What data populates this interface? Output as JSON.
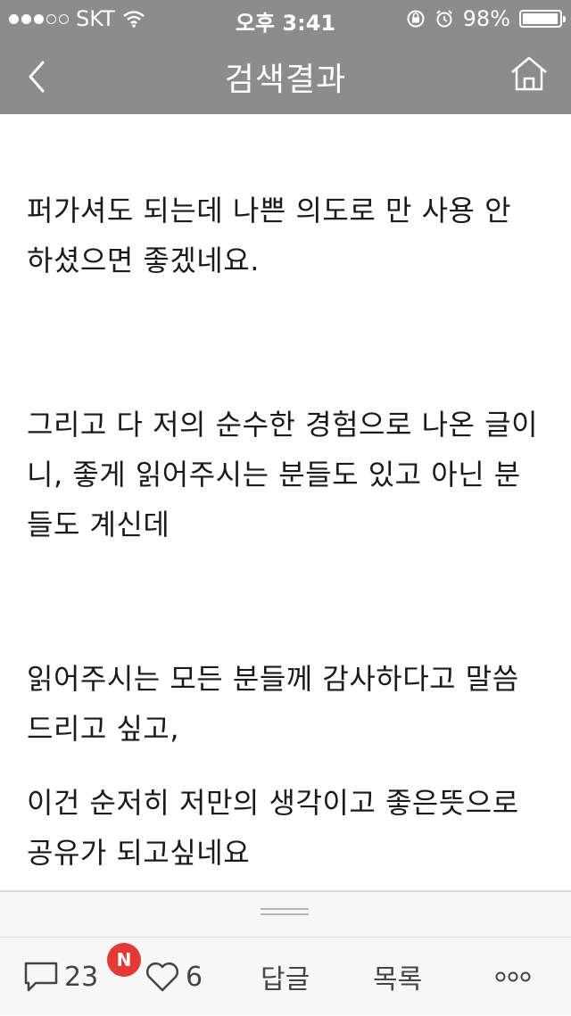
{
  "status_bar": {
    "signal_full": 3,
    "signal_empty": 2,
    "carrier": "SKT",
    "time": "오후 3:41",
    "battery_percent": "98%",
    "battery_level": 0.98
  },
  "nav": {
    "title": "검색결과",
    "back_icon": "chevron-left-icon",
    "home_icon": "home-icon"
  },
  "content": {
    "paragraphs": [
      "퍼가셔도 되는데 나쁜 의도로 만 사용 안 하셨으면 좋겠네요.",
      "그리고 다 저의 순수한 경험으로 나온 글이니, 좋게 읽어주시는 분들도 있고 아닌 분들도 계신데",
      "읽어주시는 모든 분들께 감사하다고 말씀드리고 싶고,",
      "이건 순저히 저만의 생각이고 좋은뜻으로 공유가 되고싶네요"
    ]
  },
  "toolbar": {
    "new_badge": "N",
    "comment_count": "23",
    "like_count": "6",
    "reply_label": "답글",
    "list_label": "목록",
    "more_icon": "more-dots-icon"
  },
  "colors": {
    "header_bg": "#8c8c8c",
    "badge_red": "#e53935",
    "toolbar_bg": "#f7f7f7"
  }
}
